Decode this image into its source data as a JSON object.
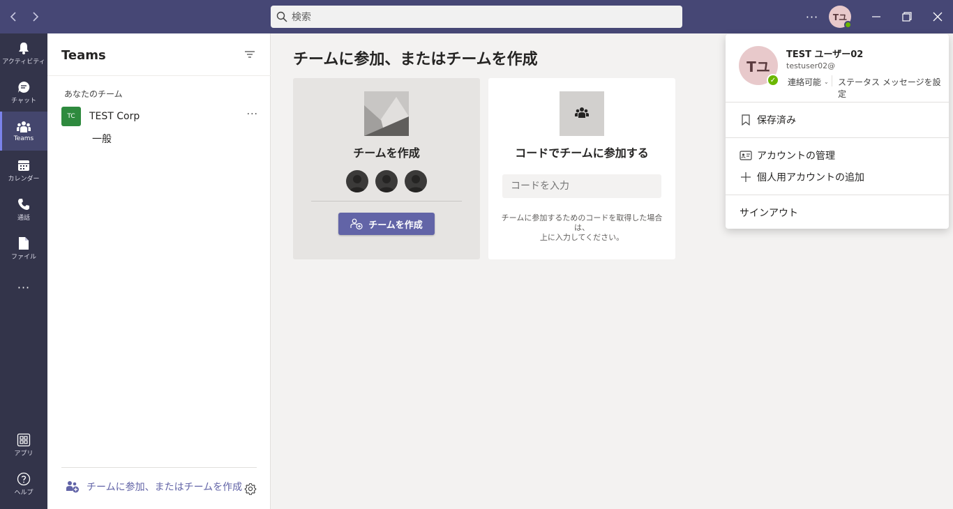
{
  "titlebar": {
    "search_placeholder": "検索",
    "avatar_initials": "Tユ",
    "more": "···"
  },
  "rail": {
    "items": [
      {
        "label": "アクティビティ",
        "icon": "bell-icon"
      },
      {
        "label": "チャット",
        "icon": "chat-icon"
      },
      {
        "label": "Teams",
        "icon": "teams-icon",
        "active": true
      },
      {
        "label": "カレンダー",
        "icon": "calendar-icon"
      },
      {
        "label": "通話",
        "icon": "phone-icon"
      },
      {
        "label": "ファイル",
        "icon": "file-icon"
      }
    ],
    "more": "···",
    "apps_label": "アプリ",
    "help_label": "ヘルプ"
  },
  "pane": {
    "title": "Teams",
    "section_label": "あなたのチーム",
    "team": {
      "initials": "TC",
      "name": "TEST Corp",
      "color": "#2e8a3e",
      "more": "···"
    },
    "channel": "一般",
    "join_label": "チームに参加、またはチームを作成"
  },
  "main": {
    "title": "チームに参加、またはチームを作成",
    "create_card": {
      "title": "チームを作成",
      "button_label": "チームを作成"
    },
    "join_card": {
      "title": "コードでチームに参加する",
      "input_placeholder": "コードを入力",
      "hint_line1": "チームに参加するためのコードを取得した場合は、",
      "hint_line2": "上に入力してください。"
    }
  },
  "profile_menu": {
    "avatar_initials": "Tユ",
    "name": "TEST ユーザー02",
    "email": "testuser02@",
    "status": "連絡可能",
    "set_status_message": "ステータス メッセージを設定",
    "saved": "保存済み",
    "manage_account": "アカウントの管理",
    "add_personal_account": "個人用アカウントの追加",
    "sign_out": "サインアウト"
  },
  "colors": {
    "titlebar": "#464775",
    "rail": "#33344a",
    "accent": "#6264a7",
    "available": "#6bb700"
  }
}
